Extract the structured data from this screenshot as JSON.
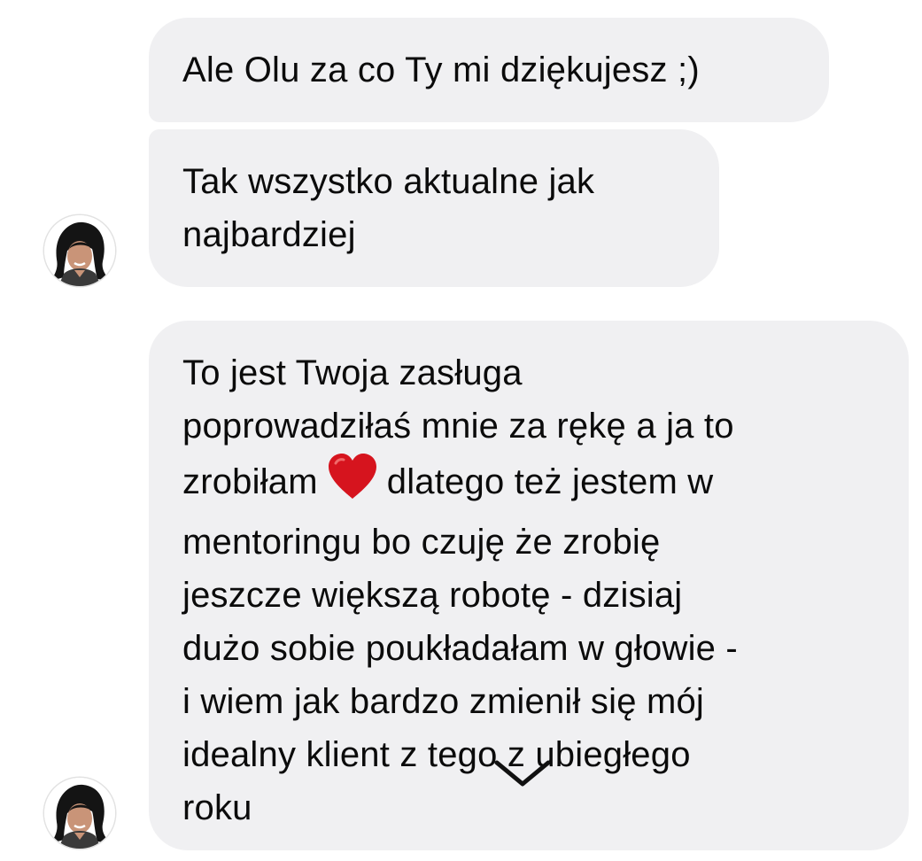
{
  "messages": [
    {
      "lines": [
        "Ale Olu za co Ty mi dziękujesz ;)"
      ]
    },
    {
      "lines": [
        "Tak wszystko aktualne jak",
        "najbardziej"
      ]
    },
    {
      "line_1": "To jest Twoja zasługa",
      "line_2": "poprowadziłaś mnie za rękę a ja to",
      "line_3_before": "zrobiłam",
      "line_3_after": "dlatego też jestem w",
      "line_4": "mentoringu bo czuję że zrobię",
      "line_5": "jeszcze większą robotę - dzisiaj",
      "line_6": "dużo sobie poukładałam w głowie -",
      "line_7": "i wiem jak bardzo zmienił się mój",
      "line_8": "idealny klient z tego z ubiegłego",
      "line_9": "roku"
    }
  ],
  "icons": {
    "heart": "red-heart-emoji",
    "scroll": "chevron-down-icon",
    "heart_color": "#d6141e"
  }
}
